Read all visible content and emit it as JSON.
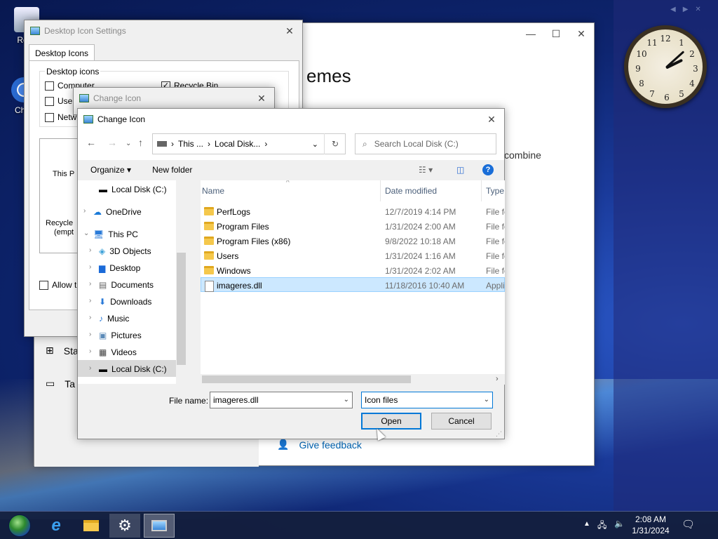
{
  "desktop": {
    "icons": [
      {
        "label": "Recy",
        "icon": "recycle-bin-icon"
      },
      {
        "label": "Chro",
        "icon": "chrome-icon"
      }
    ]
  },
  "clock": {
    "numbers": [
      "12",
      "1",
      "2",
      "3",
      "4",
      "5",
      "6",
      "7",
      "8",
      "9",
      "10",
      "11"
    ],
    "time": "2:08"
  },
  "settings_window": {
    "heading": "emes",
    "subtext": "combine",
    "nav": [
      {
        "label": "Sta",
        "icon": "start-icon"
      },
      {
        "label": "Ta",
        "icon": "taskbar-icon"
      }
    ],
    "feedback": "Give feedback",
    "controls": {
      "minimize": "—",
      "maximize": "☐",
      "close": "✕"
    }
  },
  "desktop_icon_settings": {
    "title": "Desktop Icon Settings",
    "tab": "Desktop Icons",
    "group_label": "Desktop icons",
    "checkboxes": [
      {
        "label": "Computer",
        "checked": false
      },
      {
        "label": "User",
        "checked": false
      },
      {
        "label": "Netw",
        "checked": false
      },
      {
        "label": "Recycle Bin",
        "checked": true
      }
    ],
    "preview_items": [
      "This P",
      "Recycle",
      "(empt"
    ],
    "allow_label": "Allow t"
  },
  "change_icon_back": {
    "title": "Change Icon"
  },
  "file_dialog": {
    "title": "Change Icon",
    "breadcrumb": [
      "This ...",
      "Local Disk...",
      ""
    ],
    "search_placeholder": "Search Local Disk (C:)",
    "organize": "Organize",
    "new_folder": "New folder",
    "tree": [
      {
        "label": "Local Disk (C:)",
        "icon": "drive-icon"
      },
      {
        "label": "OneDrive",
        "icon": "onedrive-icon"
      },
      {
        "label": "This PC",
        "icon": "computer-icon"
      },
      {
        "label": "3D Objects",
        "icon": "3d-objects-icon"
      },
      {
        "label": "Desktop",
        "icon": "desktop-folder-icon"
      },
      {
        "label": "Documents",
        "icon": "documents-icon"
      },
      {
        "label": "Downloads",
        "icon": "downloads-icon"
      },
      {
        "label": "Music",
        "icon": "music-icon"
      },
      {
        "label": "Pictures",
        "icon": "pictures-icon"
      },
      {
        "label": "Videos",
        "icon": "videos-icon"
      },
      {
        "label": "Local Disk (C:)",
        "icon": "drive-icon"
      }
    ],
    "columns": {
      "name": "Name",
      "date": "Date modified",
      "type": "Type"
    },
    "rows": [
      {
        "name": "PerfLogs",
        "date": "12/7/2019 4:14 PM",
        "type": "File fo",
        "kind": "folder"
      },
      {
        "name": "Program Files",
        "date": "1/31/2024 2:00 AM",
        "type": "File fo",
        "kind": "folder"
      },
      {
        "name": "Program Files (x86)",
        "date": "9/8/2022 10:18 AM",
        "type": "File fo",
        "kind": "folder"
      },
      {
        "name": "Users",
        "date": "1/31/2024 1:16 AM",
        "type": "File fo",
        "kind": "folder"
      },
      {
        "name": "Windows",
        "date": "1/31/2024 2:02 AM",
        "type": "File fo",
        "kind": "folder"
      },
      {
        "name": "imageres.dll",
        "date": "11/18/2016 10:40 AM",
        "type": "Appli",
        "kind": "dll"
      }
    ],
    "file_name_label": "File name:",
    "file_name_value": "imageres.dll",
    "file_type": "Icon files",
    "open": "Open",
    "cancel": "Cancel"
  },
  "taskbar": {
    "time": "2:08 AM",
    "date": "1/31/2024"
  }
}
